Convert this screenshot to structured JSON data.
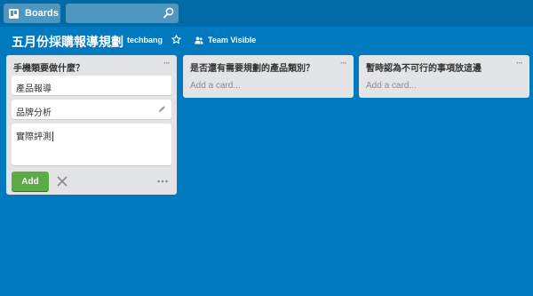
{
  "header": {
    "boards_label": "Boards",
    "search_value": ""
  },
  "board": {
    "title": "五月份採購報導規劃",
    "org": "techbang",
    "visibility": "Team Visible"
  },
  "lists": [
    {
      "title": "手機類要做什麼？",
      "menu": "···",
      "cards": [
        "產品報導",
        "品牌分析"
      ],
      "composer_text": "實際評測",
      "add_button": "Add"
    },
    {
      "title": "是否還有需要規劃的產品類別？",
      "menu": "···",
      "add_card": "Add a card..."
    },
    {
      "title": "暫時認為不可行的事項放這邊",
      "menu": "···",
      "add_card": "Add a card..."
    }
  ],
  "colors": {
    "background": "#0079bf",
    "header": "#026aa7",
    "list": "#e2e4e6",
    "add_button": "#5aac44"
  }
}
